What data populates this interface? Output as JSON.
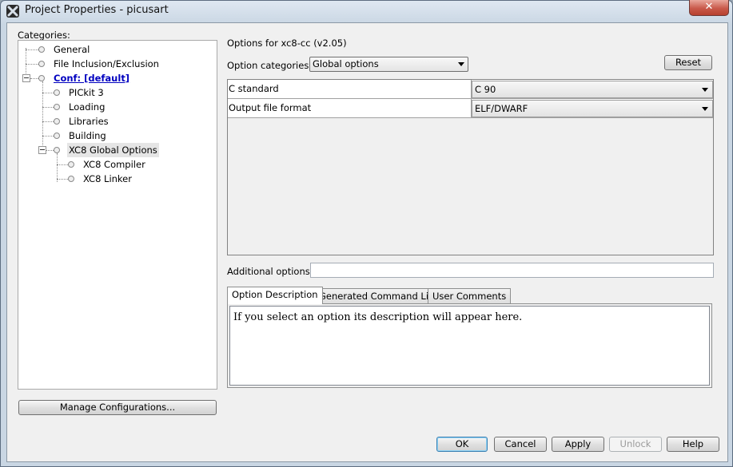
{
  "window": {
    "title": "Project Properties - picusart",
    "close_label": "✕"
  },
  "categories": {
    "label": "Categories:",
    "items": [
      {
        "label": "General"
      },
      {
        "label": "File Inclusion/Exclusion"
      },
      {
        "label": "Conf: [default]"
      },
      {
        "label": "PICkit 3"
      },
      {
        "label": "Loading"
      },
      {
        "label": "Libraries"
      },
      {
        "label": "Building"
      },
      {
        "label": "XC8 Global Options"
      },
      {
        "label": "XC8 Compiler"
      },
      {
        "label": "XC8 Linker"
      }
    ],
    "manage_button": "Manage Configurations..."
  },
  "options": {
    "header": "Options for xc8-cc (v2.05)",
    "category_label": "Option categories:",
    "category_value": "Global options",
    "reset_button": "Reset",
    "rows": [
      {
        "name": "C standard",
        "value": "C 90"
      },
      {
        "name": "Output file format",
        "value": "ELF/DWARF"
      }
    ],
    "additional_label": "Additional options:",
    "additional_value": ""
  },
  "tabs": {
    "items": [
      "Option Description",
      "Generated Command Line",
      "User Comments"
    ],
    "active": "Option Description",
    "description": "If you select an option its description will appear here."
  },
  "footer": {
    "ok": "OK",
    "cancel": "Cancel",
    "apply": "Apply",
    "unlock": "Unlock",
    "help": "Help"
  }
}
